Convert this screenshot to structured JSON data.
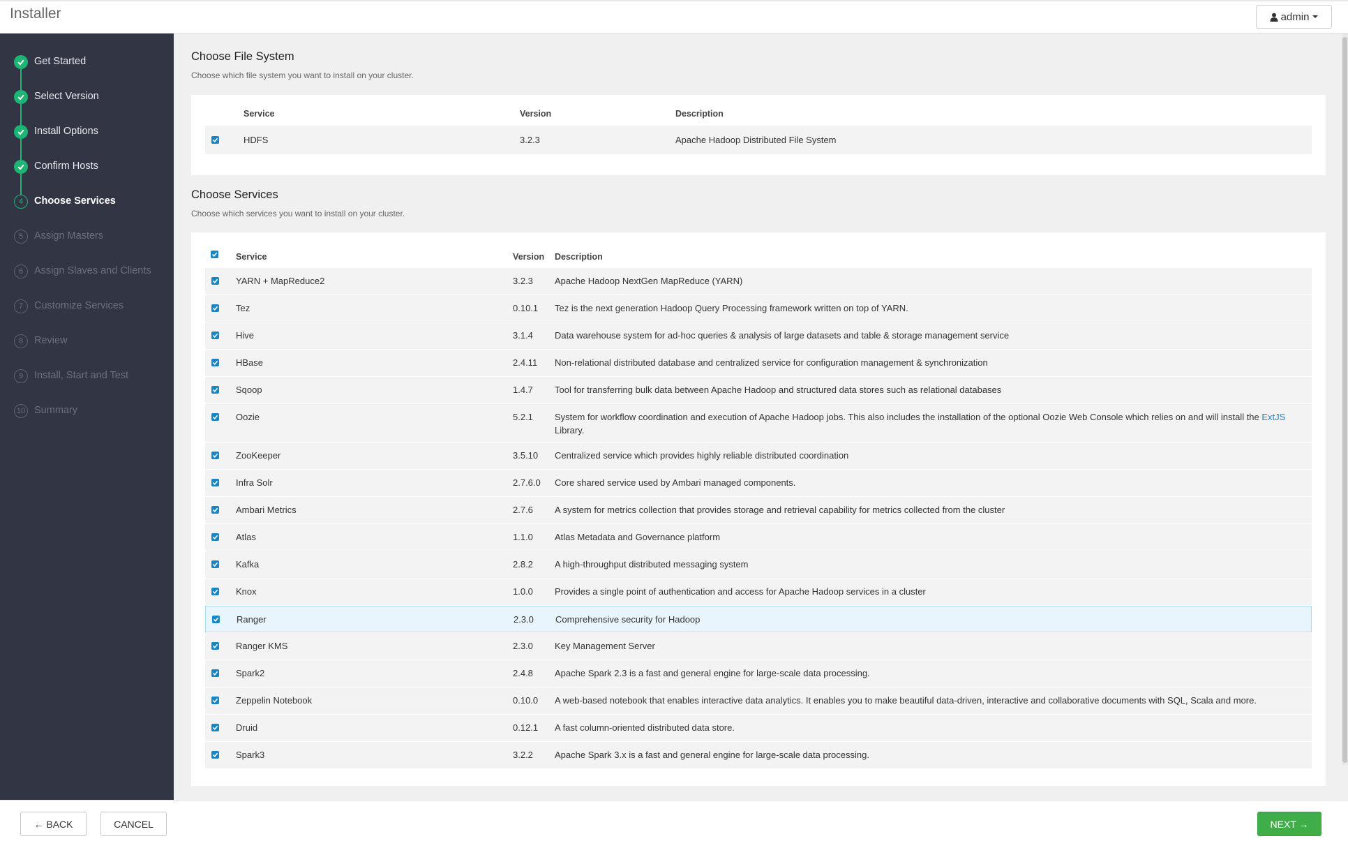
{
  "app": {
    "title": "Installer",
    "user": "admin"
  },
  "sidebar": {
    "steps": [
      {
        "num": "",
        "label": "Get Started",
        "state": "done"
      },
      {
        "num": "",
        "label": "Select Version",
        "state": "done"
      },
      {
        "num": "",
        "label": "Install Options",
        "state": "done"
      },
      {
        "num": "",
        "label": "Confirm Hosts",
        "state": "done"
      },
      {
        "num": "4",
        "label": "Choose Services",
        "state": "current"
      },
      {
        "num": "5",
        "label": "Assign Masters",
        "state": "pending"
      },
      {
        "num": "6",
        "label": "Assign Slaves and Clients",
        "state": "pending"
      },
      {
        "num": "7",
        "label": "Customize Services",
        "state": "pending"
      },
      {
        "num": "8",
        "label": "Review",
        "state": "pending"
      },
      {
        "num": "9",
        "label": "Install, Start and Test",
        "state": "pending"
      },
      {
        "num": "10",
        "label": "Summary",
        "state": "pending"
      }
    ]
  },
  "filesystem": {
    "title": "Choose File System",
    "subtitle": "Choose which file system you want to install on your cluster.",
    "headers": {
      "service": "Service",
      "version": "Version",
      "description": "Description"
    },
    "rows": [
      {
        "service": "HDFS",
        "version": "3.2.3",
        "description": "Apache Hadoop Distributed File System",
        "checked": true
      }
    ]
  },
  "services": {
    "title": "Choose Services",
    "subtitle": "Choose which services you want to install on your cluster.",
    "headers": {
      "service": "Service",
      "version": "Version",
      "description": "Description"
    },
    "rows": [
      {
        "service": "YARN + MapReduce2",
        "version": "3.2.3",
        "description": "Apache Hadoop NextGen MapReduce (YARN)"
      },
      {
        "service": "Tez",
        "version": "0.10.1",
        "description": "Tez is the next generation Hadoop Query Processing framework written on top of YARN."
      },
      {
        "service": "Hive",
        "version": "3.1.4",
        "description": "Data warehouse system for ad-hoc queries & analysis of large datasets and table & storage management service"
      },
      {
        "service": "HBase",
        "version": "2.4.11",
        "description": "Non-relational distributed database and centralized service for configuration management & synchronization"
      },
      {
        "service": "Sqoop",
        "version": "1.4.7",
        "description": "Tool for transferring bulk data between Apache Hadoop and structured data stores such as relational databases"
      },
      {
        "service": "Oozie",
        "version": "5.2.1",
        "description": "System for workflow coordination and execution of Apache Hadoop jobs. This also includes the installation of the optional Oozie Web Console which relies on and will install the",
        "link": "ExtJS",
        "description_tail": "Library."
      },
      {
        "service": "ZooKeeper",
        "version": "3.5.10",
        "description": "Centralized service which provides highly reliable distributed coordination"
      },
      {
        "service": "Infra Solr",
        "version": "2.7.6.0",
        "description": "Core shared service used by Ambari managed components."
      },
      {
        "service": "Ambari Metrics",
        "version": "2.7.6",
        "description": "A system for metrics collection that provides storage and retrieval capability for metrics collected from the cluster"
      },
      {
        "service": "Atlas",
        "version": "1.1.0",
        "description": "Atlas Metadata and Governance platform"
      },
      {
        "service": "Kafka",
        "version": "2.8.2",
        "description": "A high-throughput distributed messaging system"
      },
      {
        "service": "Knox",
        "version": "1.0.0",
        "description": "Provides a single point of authentication and access for Apache Hadoop services in a cluster"
      },
      {
        "service": "Ranger",
        "version": "2.3.0",
        "description": "Comprehensive security for Hadoop",
        "highlight": true
      },
      {
        "service": "Ranger KMS",
        "version": "2.3.0",
        "description": "Key Management Server"
      },
      {
        "service": "Spark2",
        "version": "2.4.8",
        "description": "Apache Spark 2.3 is a fast and general engine for large-scale data processing."
      },
      {
        "service": "Zeppelin Notebook",
        "version": "0.10.0",
        "description": "A web-based notebook that enables interactive data analytics. It enables you to make beautiful data-driven, interactive and collaborative documents with SQL, Scala and more."
      },
      {
        "service": "Druid",
        "version": "0.12.1",
        "description": "A fast column-oriented distributed data store."
      },
      {
        "service": "Spark3",
        "version": "3.2.2",
        "description": "Apache Spark 3.x is a fast and general engine for large-scale data processing."
      }
    ]
  },
  "footer": {
    "back": "← BACK",
    "cancel": "CANCEL",
    "next": "NEXT →"
  },
  "colors": {
    "accent": "#1eb475",
    "checkbox": "#1786c5",
    "next": "#3fae49",
    "sidebar": "#323544"
  }
}
